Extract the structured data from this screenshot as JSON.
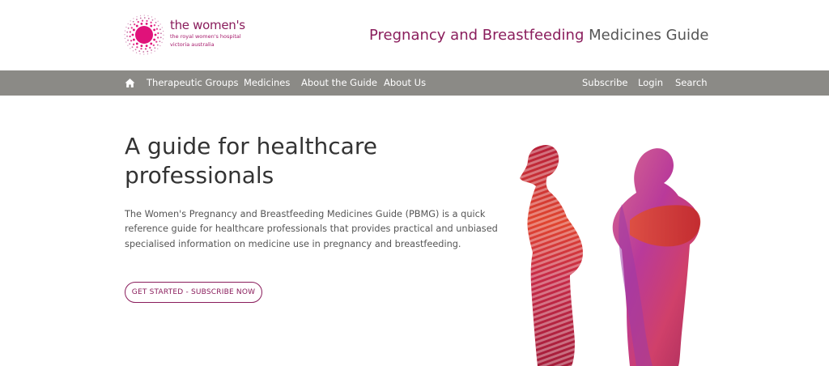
{
  "brand": {
    "name": "the women's",
    "subtitle": "the royal women's hospital",
    "location": "victoria australia",
    "color": "#a6196b"
  },
  "site_title": {
    "accent": "Pregnancy and Breastfeeding",
    "rest": " Medicines Guide"
  },
  "nav": {
    "left": [
      "Therapeutic Groups",
      "Medicines",
      "About the Guide",
      "About Us"
    ],
    "right": [
      "Subscribe",
      "Login",
      "Search"
    ],
    "home_icon": "home-icon",
    "background": "#8b8a86"
  },
  "hero": {
    "title": "A guide for healthcare professionals",
    "description": "The Women's Pregnancy and Breastfeeding Medicines Guide (PBMG) is a quick reference guide for healthcare professionals that provides practical and unbiased specialised information on medicine use in pregnancy and breastfeeding.",
    "cta_label": "GET STARTED - SUBSCRIBE NOW"
  },
  "colors": {
    "accent": "#8a1d5c",
    "text": "#333333"
  }
}
